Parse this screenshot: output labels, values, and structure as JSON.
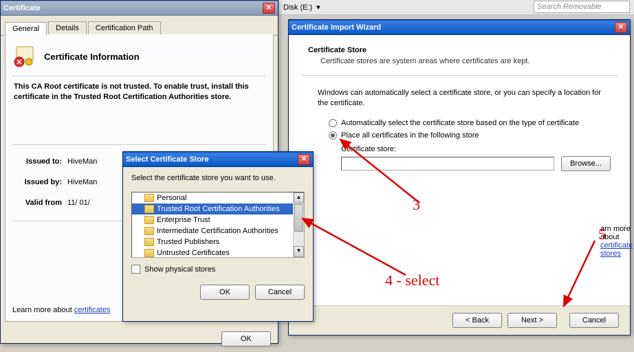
{
  "bg": {
    "disk_label": "Disk (E:)",
    "dropdown_icon": "▾",
    "search_placeholder": "Search Removable"
  },
  "cert_window": {
    "title": "Certificate",
    "tabs": [
      "General",
      "Details",
      "Certification Path"
    ],
    "heading": "Certificate Information",
    "warning": "This CA Root certificate is not trusted. To enable trust, install this certificate in the Trusted Root Certification Authorities store.",
    "issued_to_label": "Issued to:",
    "issued_to": "HiveMan",
    "issued_by_label": "Issued by:",
    "issued_by": "HiveMan",
    "valid_from_label": "Valid from",
    "valid_from": "11/ 01/",
    "learn_more_prefix": "Learn more about ",
    "learn_more_link": "certificates",
    "ok": "OK"
  },
  "select_store": {
    "title": "Select Certificate Store",
    "prompt": "Select the certificate store you want to use.",
    "items": [
      "Personal",
      "Trusted Root Certification Authorities",
      "Enterprise Trust",
      "Intermediate Certification Authorities",
      "Trusted Publishers",
      "Untrusted Certificates"
    ],
    "selected_index": 1,
    "show_physical": "Show physical stores",
    "ok": "OK",
    "cancel": "Cancel"
  },
  "wizard": {
    "title": "Certificate Import Wizard",
    "section_title": "Certificate Store",
    "section_desc": "Certificate stores are system areas where certificates are kept.",
    "intro": "Windows can automatically select a certificate store, or you can specify a location for the certificate.",
    "radio_auto": "Automatically select the certificate store based on the type of certificate",
    "radio_place": "Place all certificates in the following store",
    "store_label": "Certificate store:",
    "store_value": "",
    "browse": "Browse...",
    "learn_prefix": "arn more about ",
    "learn_link": "certificate stores",
    "back": "< Back",
    "next": "Next >",
    "cancel": "Cancel"
  },
  "annotations": {
    "a3": "3",
    "a4": "4 - select",
    "a5": "5"
  }
}
